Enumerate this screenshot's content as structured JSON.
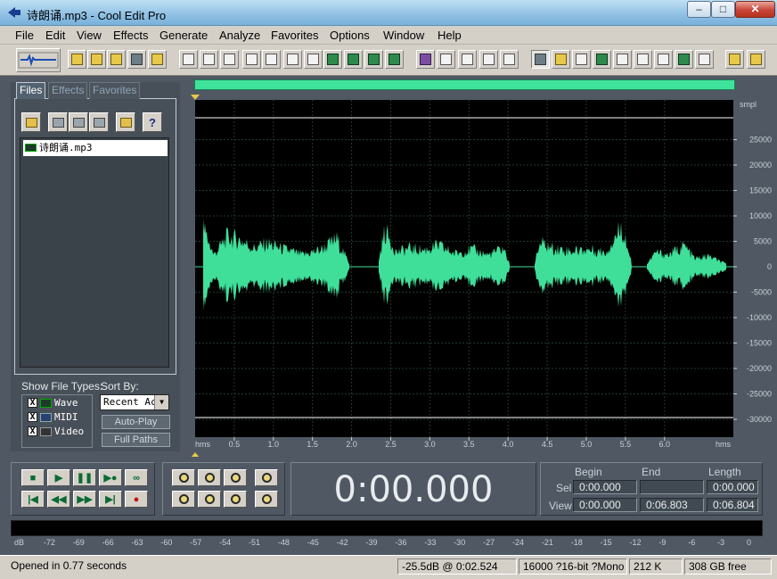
{
  "window": {
    "title": "诗朗诵.mp3 - Cool Edit Pro",
    "min": "–",
    "max": "□",
    "close": "✕"
  },
  "menu": [
    "File",
    "Edit",
    "View",
    "Effects",
    "Generate",
    "Analyze",
    "Favorites",
    "Options",
    "Window",
    "Help"
  ],
  "left_panel": {
    "tabs": [
      "Files",
      "Effects",
      "Favorites"
    ],
    "help_glyph": "?",
    "files": [
      "诗朗诵.mp3"
    ],
    "show_file_types_label": "Show File Types:",
    "file_types": [
      {
        "label": "Wave",
        "checked": true
      },
      {
        "label": "MIDI",
        "checked": true
      },
      {
        "label": "Video",
        "checked": true
      }
    ],
    "check_glyph": "X",
    "sort_by_label": "Sort By:",
    "sort_value": "Recent Acc",
    "auto_play": "Auto-Play",
    "full_paths": "Full Paths"
  },
  "waveform": {
    "unit_label": "smpl",
    "y_ticks": [
      "25000",
      "20000",
      "15000",
      "10000",
      "5000",
      "0",
      "-5000",
      "-10000",
      "-15000",
      "-20000",
      "-25000",
      "-30000"
    ],
    "time_unit": "hms",
    "x_ticks": [
      "0.5",
      "1.0",
      "1.5",
      "2.0",
      "2.5",
      "3.0",
      "3.5",
      "4.0",
      "4.5",
      "5.0",
      "5.5",
      "6.0"
    ],
    "colors": {
      "wave": "#3fdf9a",
      "background": "#000000",
      "grid": "#213a2e"
    }
  },
  "transport": {
    "time": "0:00.000"
  },
  "selection": {
    "headers": [
      "Begin",
      "End",
      "Length"
    ],
    "rows": [
      {
        "label": "Sel",
        "begin": "0:00.000",
        "end": "",
        "length": "0:00.000"
      },
      {
        "label": "View",
        "begin": "0:00.000",
        "end": "0:06.803",
        "length": "0:06.804"
      }
    ]
  },
  "level_scale": [
    "dB",
    "-72",
    "-69",
    "-66",
    "-63",
    "-60",
    "-57",
    "-54",
    "-51",
    "-48",
    "-45",
    "-42",
    "-39",
    "-36",
    "-33",
    "-30",
    "-27",
    "-24",
    "-21",
    "-18",
    "-15",
    "-12",
    "-9",
    "-6",
    "-3",
    "0"
  ],
  "status": {
    "message": "Opened in 0.77 seconds",
    "cursor": "-25.5dB @  0:02.524",
    "format": "16000 ?16-bit ?Mono",
    "size": "212 K",
    "free": "308 GB free"
  }
}
